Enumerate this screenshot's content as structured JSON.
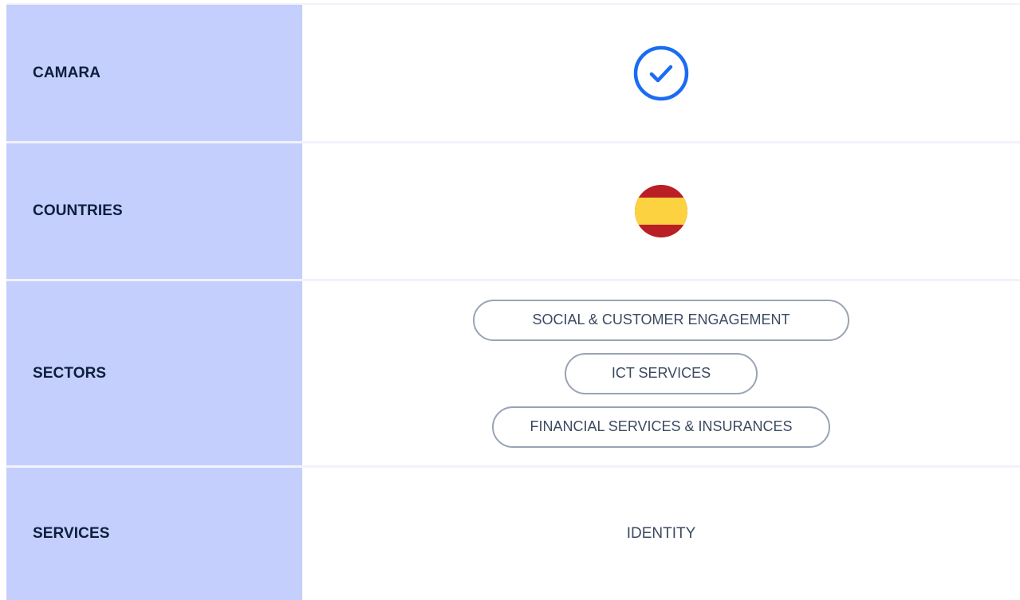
{
  "rows": [
    {
      "label": "CAMARA",
      "value_type": "check",
      "icon": "check-circle-icon",
      "icon_color": "#1a6cf2"
    },
    {
      "label": "COUNTRIES",
      "value_type": "flag",
      "icon": "spain-flag-icon",
      "flag_colors": {
        "red": "#b91f25",
        "yellow": "#fdd240"
      }
    },
    {
      "label": "SECTORS",
      "value_type": "chips",
      "chips": [
        "SOCIAL & CUSTOMER ENGAGEMENT",
        "ICT SERVICES",
        "FINANCIAL SERVICES & INSURANCES"
      ]
    },
    {
      "label": "SERVICES",
      "value_type": "text",
      "value": "IDENTITY"
    }
  ],
  "colors": {
    "label_bg": "#c4cffd",
    "label_text": "#0c1f3d",
    "chip_border": "#9aa3b5",
    "value_text": "#3c4a61",
    "divider": "#f1f3fb"
  }
}
